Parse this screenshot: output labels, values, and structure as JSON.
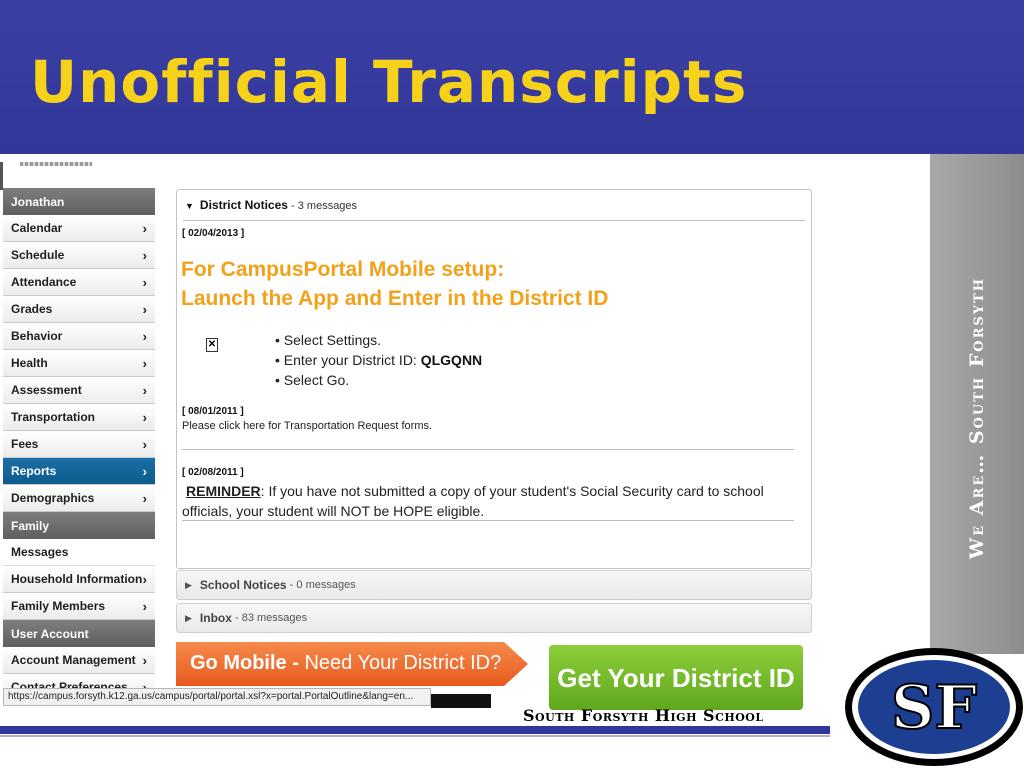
{
  "slide": {
    "title": "Unofficial Transcripts",
    "side_text": "We Are… South Forsyth",
    "footer_school": "South Forsyth High School",
    "logo_text": "SF",
    "colors": {
      "header_bg": "#3b3fa3",
      "title": "#f7d21a",
      "side_band": "#999999",
      "footer_line": "#31379a"
    }
  },
  "sidebar": {
    "user": "Jonathan",
    "items": [
      {
        "label": "Calendar"
      },
      {
        "label": "Schedule"
      },
      {
        "label": "Attendance"
      },
      {
        "label": "Grades"
      },
      {
        "label": "Behavior"
      },
      {
        "label": "Health"
      },
      {
        "label": "Assessment"
      },
      {
        "label": "Transportation"
      },
      {
        "label": "Fees"
      },
      {
        "label": "Reports",
        "active": true
      },
      {
        "label": "Demographics"
      }
    ],
    "family_header": "Family",
    "family_items": [
      {
        "label": "Messages",
        "selected": true
      },
      {
        "label": "Household Information"
      },
      {
        "label": "Family Members"
      }
    ],
    "account_header": "User Account",
    "account_items": [
      {
        "label": "Account Management"
      },
      {
        "label": "Contact Preferences"
      }
    ]
  },
  "district_notices": {
    "title": "District Notices",
    "count": "3 messages",
    "notice1": {
      "date": "[ 02/04/2013 ]",
      "line1": "For CampusPortal Mobile setup:",
      "line2": "Launch the App and Enter in the District ID",
      "bullets": [
        "Select Settings.",
        "Enter your District ID:",
        "Select Go."
      ],
      "district_id": "QLGQNN"
    },
    "notice2": {
      "date": "[ 08/01/2011 ]",
      "text": "Please  click here for Transportation Request forms."
    },
    "notice3": {
      "date": "[ 02/08/2011 ]",
      "reminder_label": "REMINDER",
      "text": ":  If you have not submitted a copy of your student's Social Security card to school officials, your student will NOT be HOPE eligible."
    }
  },
  "school_notices": {
    "title": "School Notices",
    "count": "0 messages"
  },
  "inbox": {
    "title": "Inbox",
    "count": "83 messages"
  },
  "banners": {
    "go_mobile_bold": "Go Mobile -",
    "go_mobile_rest": " Need Your District ID?",
    "get_id": "Get Your District ID"
  },
  "status_url": "https://campus.forsyth.k12.ga.us/campus/portal/portal.xsl?x=portal.PortalOutline&lang=en..."
}
